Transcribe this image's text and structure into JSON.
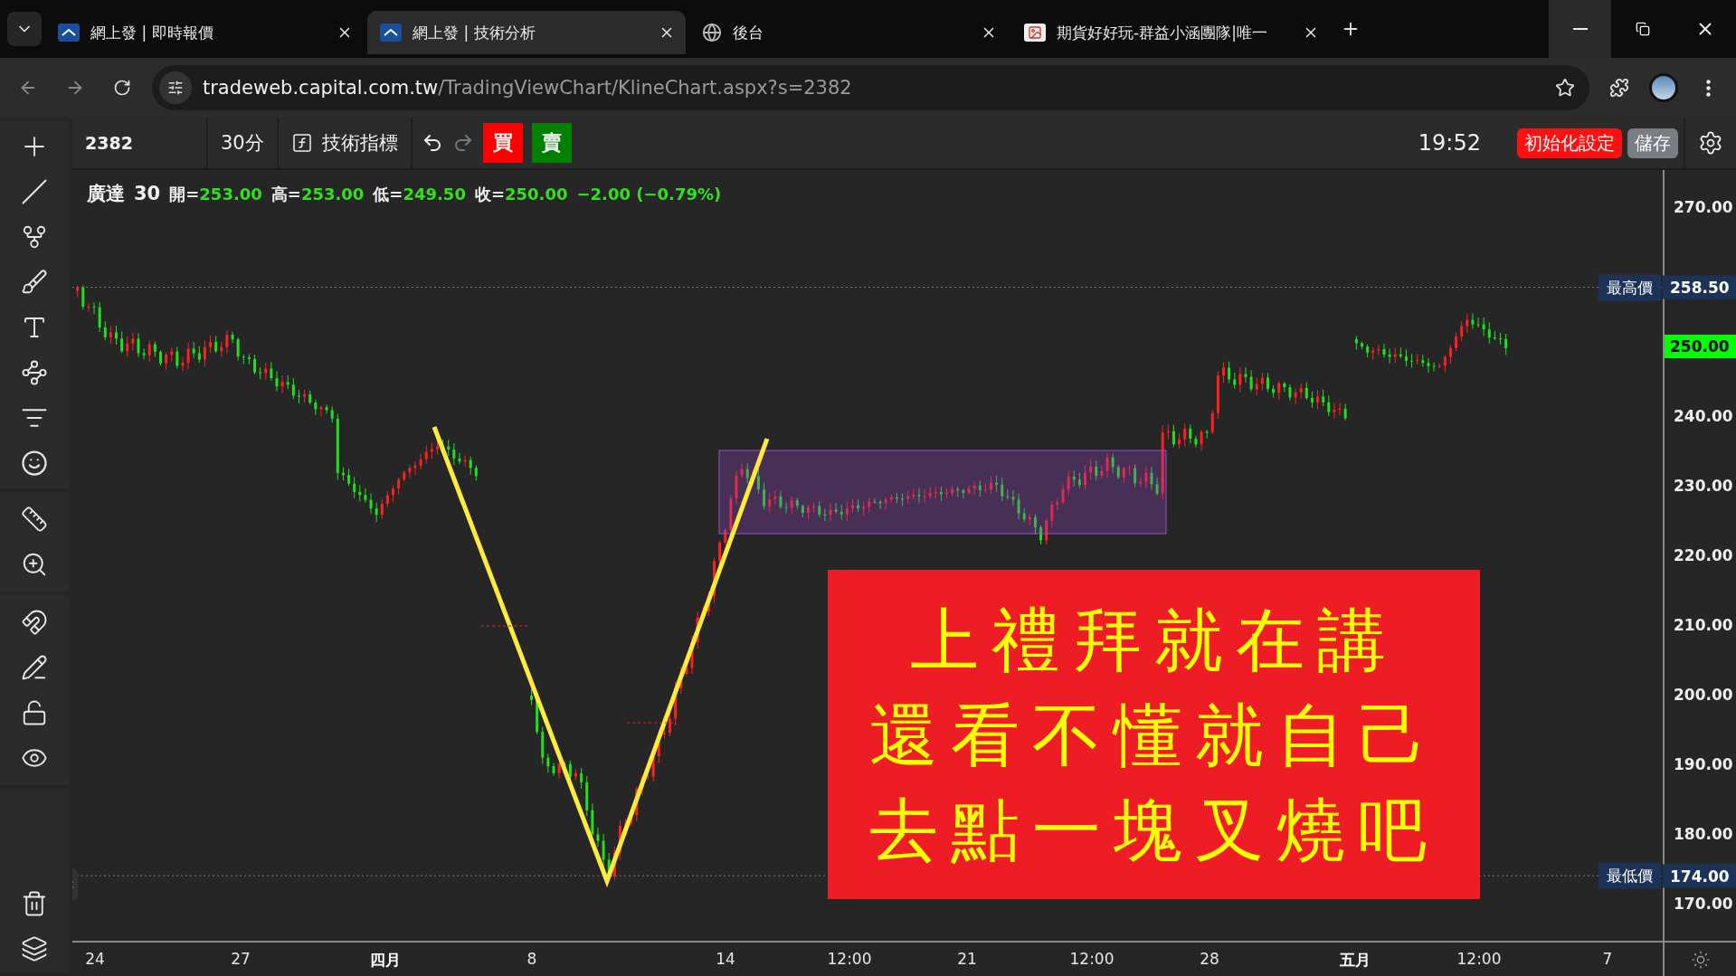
{
  "browser": {
    "tabs": [
      {
        "title": "網上發 | 即時報價",
        "selected": false
      },
      {
        "title": "網上發 | 技術分析",
        "selected": true
      },
      {
        "title": "後台",
        "selected": false
      },
      {
        "title": "期貨好好玩-群益小涵團隊|唯一",
        "selected": false
      }
    ],
    "url_host": "tradeweb.capital.com.tw",
    "url_path": "/TradingViewChart/KlineChart.aspx?s=2382"
  },
  "toolbar": {
    "symbol": "2382",
    "interval": "30分",
    "indicators": "技術指標",
    "trade_buttons": [
      {
        "label": "買",
        "color": "#ff0000"
      },
      {
        "label": "賣",
        "color": "#008000"
      }
    ],
    "time": "19:52",
    "reset": "初始化設定",
    "save": "儲存"
  },
  "legend": {
    "name": "廣達",
    "interval": "30",
    "fields": [
      {
        "label": "開=",
        "value": "253.00"
      },
      {
        "label": "高=",
        "value": "253.00"
      },
      {
        "label": "低=",
        "value": "249.50"
      },
      {
        "label": "收=",
        "value": "250.00"
      }
    ],
    "change": "−2.00 (−0.79%)"
  },
  "price_axis": [
    "270.00",
    "240.00",
    "230.00",
    "220.00",
    "210.00",
    "200.00",
    "190.00",
    "180.00",
    "170.00"
  ],
  "markers": [
    {
      "label": "最高價",
      "value": "258.50",
      "kind": "high"
    },
    {
      "label": "最低價",
      "value": "174.00",
      "kind": "low"
    }
  ],
  "last_price": "250.00",
  "time_axis": [
    {
      "label": "24",
      "kind": "day"
    },
    {
      "label": "27",
      "kind": "day"
    },
    {
      "label": "四月",
      "kind": "month"
    },
    {
      "label": "8",
      "kind": "day"
    },
    {
      "label": "14",
      "kind": "day"
    },
    {
      "label": "12:00",
      "kind": "day"
    },
    {
      "label": "21",
      "kind": "day"
    },
    {
      "label": "12:00",
      "kind": "day"
    },
    {
      "label": "28",
      "kind": "day"
    },
    {
      "label": "五月",
      "kind": "month"
    },
    {
      "label": "12:00",
      "kind": "day"
    },
    {
      "label": "7",
      "kind": "day"
    }
  ],
  "note": [
    "上禮拜就在講",
    "還看不懂就自己",
    "去點一塊叉燒吧"
  ]
}
